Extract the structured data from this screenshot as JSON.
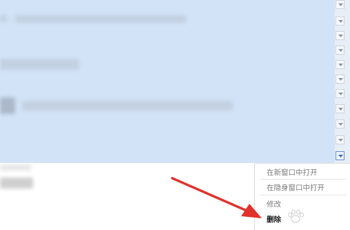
{
  "background": {
    "selection_color": "#d3e3f7",
    "page_color": "#ffffff"
  },
  "context_menu": {
    "items": [
      {
        "label": "在新窗口中打开"
      },
      {
        "label": "在隐身窗口中打开"
      },
      {
        "label": "修改"
      },
      {
        "label": "删除"
      }
    ]
  },
  "annotation": {
    "arrow_color": "#e0322b",
    "watermark_icon": "paw-print-icon"
  },
  "icons": {
    "dropdown": "chevron-down-icon"
  }
}
